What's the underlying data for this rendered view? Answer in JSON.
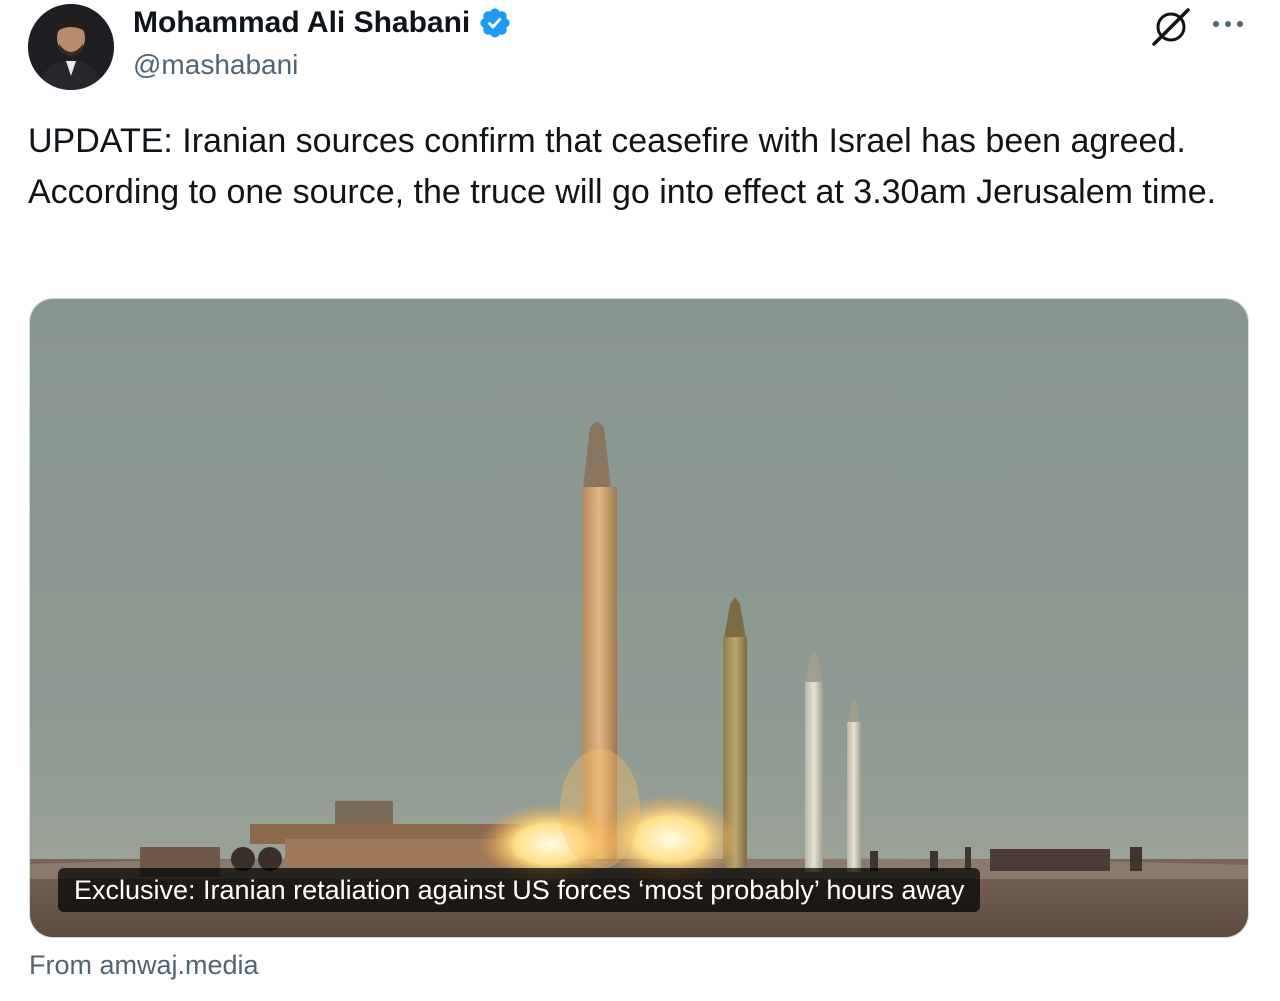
{
  "author": {
    "name": "Mohammad Ali Shabani",
    "handle": "@mashabani",
    "verified": true,
    "badge_color": "#1d9bf0"
  },
  "header_actions": {
    "grok_icon": "grok-icon",
    "more_icon": "more-options-icon"
  },
  "tweet": {
    "text": "UPDATE: Iranian sources confirm that ceasefire with Israel has been agreed. According to one source, the truce will go into effect at 3.30am Jerusalem time."
  },
  "link_card": {
    "image_description_icon": "missile-launch-photo",
    "caption": "Exclusive: Iranian retaliation against US forces ‘most probably’ hours away",
    "source": "From amwaj.media"
  },
  "colors": {
    "text_primary": "#0f1419",
    "text_secondary": "#536471",
    "sky": "#8a9892"
  }
}
